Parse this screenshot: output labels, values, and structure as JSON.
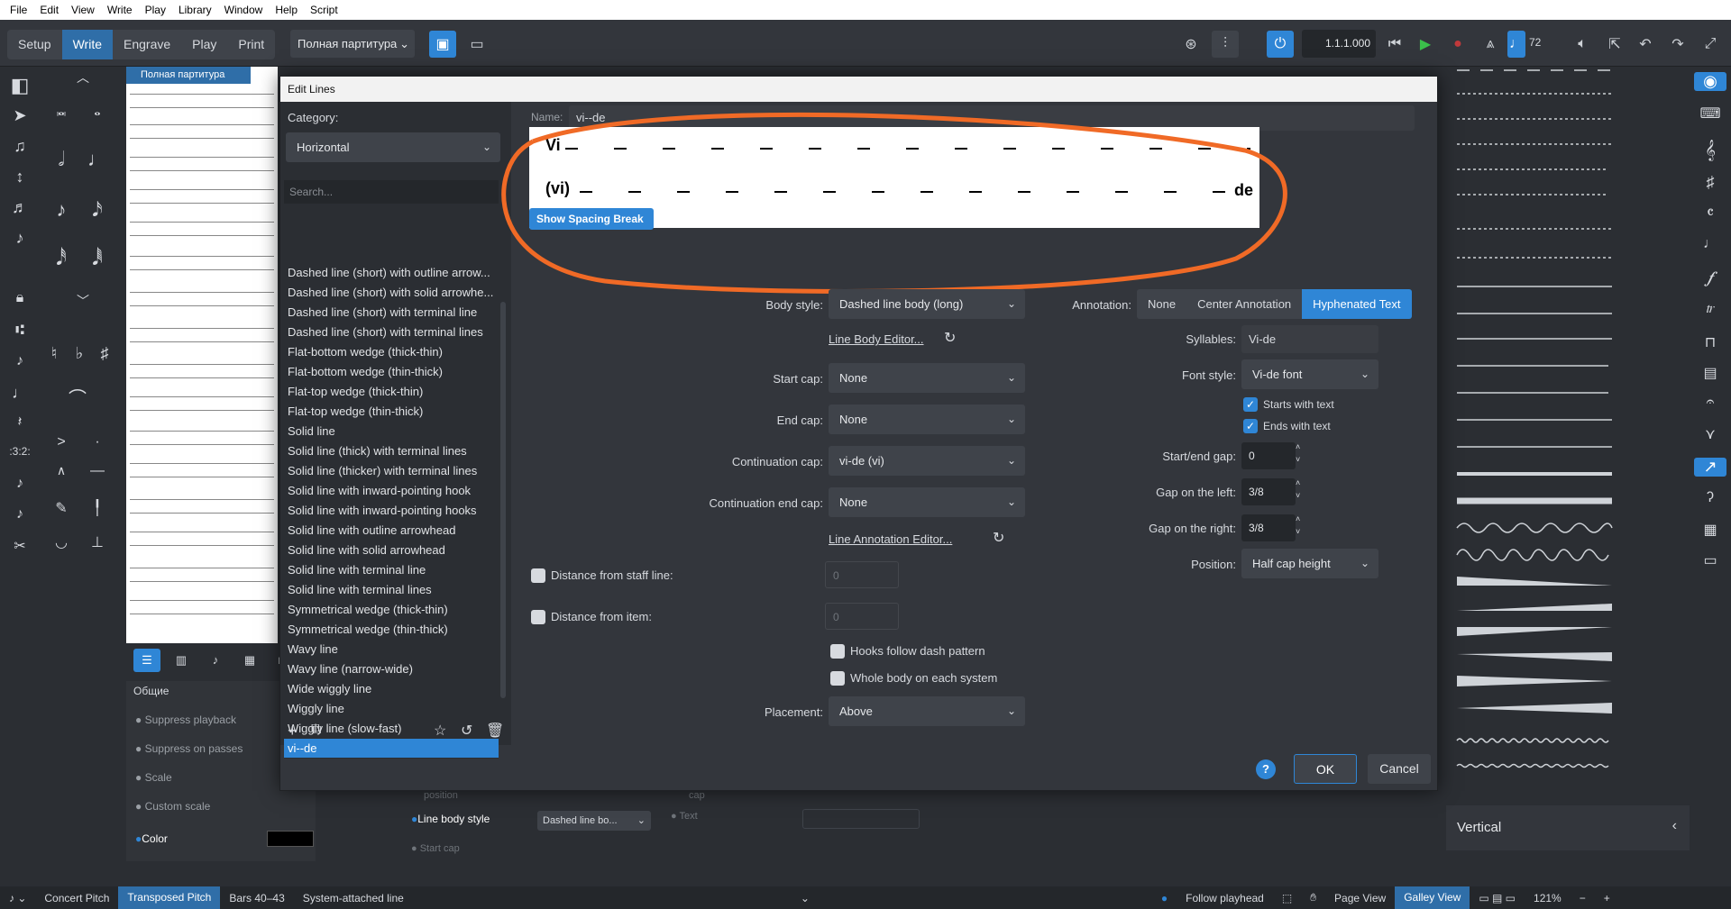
{
  "menu": [
    "File",
    "Edit",
    "View",
    "Write",
    "Play",
    "Library",
    "Window",
    "Help",
    "Script"
  ],
  "modes": [
    "Setup",
    "Write",
    "Engrave",
    "Play",
    "Print"
  ],
  "active_mode": "Write",
  "layout": "Полная партитура",
  "position": "1.1.1.000",
  "tempo": "72",
  "score_tab": "Полная партитура",
  "dialog": {
    "title": "Edit Lines",
    "category_label": "Category:",
    "category": "Horizontal",
    "search_placeholder": "Search...",
    "lines": [
      "Dashed line (short) with outline arrow...",
      "Dashed line (short) with solid arrowhe...",
      "Dashed line (short) with terminal line",
      "Dashed line (short) with terminal lines",
      "Flat-bottom wedge (thick-thin)",
      "Flat-bottom wedge (thin-thick)",
      "Flat-top wedge (thick-thin)",
      "Flat-top wedge (thin-thick)",
      "Solid line",
      "Solid line (thick) with terminal lines",
      "Solid line (thicker) with terminal lines",
      "Solid line with inward-pointing hook",
      "Solid line with inward-pointing hooks",
      "Solid line with outline arrowhead",
      "Solid line with solid arrowhead",
      "Solid line with terminal line",
      "Solid line with terminal lines",
      "Symmetrical wedge (thick-thin)",
      "Symmetrical wedge (thin-thick)",
      "Wavy line",
      "Wavy line (narrow-wide)",
      "Wide wiggly line",
      "Wiggly line",
      "Wiggly line (slow-fast)",
      "vi--de"
    ],
    "selected_line": "vi--de",
    "name_label": "Name:",
    "name_value": "vi--de",
    "preview": {
      "row1_start": "Vi",
      "row2_start": "(vi)",
      "row2_end": "de"
    },
    "show_break_label": "Show Spacing Break",
    "body_style_label": "Body style:",
    "body_style": "Dashed line body (long)",
    "line_body_editor": "Line Body Editor...",
    "start_cap_label": "Start cap:",
    "start_cap": "None",
    "end_cap_label": "End cap:",
    "end_cap": "None",
    "continuation_cap_label": "Continuation cap:",
    "continuation_cap": "vi-de (vi)",
    "continuation_end_cap_label": "Continuation end cap:",
    "continuation_end_cap": "None",
    "line_annotation_editor": "Line Annotation Editor...",
    "distance_staff_label": "Distance from staff line:",
    "distance_staff_value": "0",
    "distance_item_label": "Distance from item:",
    "distance_item_value": "0",
    "hooks_follow_label": "Hooks follow dash pattern",
    "whole_body_label": "Whole body on each system",
    "placement_label": "Placement:",
    "placement": "Above",
    "annotation_label": "Annotation:",
    "annotation_options": [
      "None",
      "Center Annotation",
      "Hyphenated Text"
    ],
    "annotation_selected": "Hyphenated Text",
    "syllables_label": "Syllables:",
    "syllables": "Vi-de",
    "font_style_label": "Font style:",
    "font_style": "Vi-de font",
    "starts_with_text": "Starts with text",
    "ends_with_text": "Ends with text",
    "start_end_gap_label": "Start/end gap:",
    "start_end_gap": "0",
    "gap_left_label": "Gap on the left:",
    "gap_left": "3/8",
    "gap_right_label": "Gap on the right:",
    "gap_right": "3/8",
    "position_label": "Position:",
    "position": "Half cap height",
    "help": "?",
    "ok": "OK",
    "cancel": "Cancel"
  },
  "properties": {
    "header": "Общие",
    "items": [
      "Suppress playback",
      "Suppress on passes",
      "Scale",
      "Custom scale",
      "Color"
    ],
    "extra": [
      "position",
      "Line body style",
      "Start cap",
      "cap",
      "Text"
    ],
    "line_body_value": "Dashed line bo..."
  },
  "right_panel": {
    "footer": "Vertical"
  },
  "status": {
    "concert": "Concert Pitch",
    "transposed": "Transposed Pitch",
    "bars": "Bars 40–43",
    "selection": "System-attached line",
    "follow": "Follow playhead",
    "page_view": "Page View",
    "galley_view": "Galley View",
    "zoom": "121%"
  },
  "colors": {
    "accent": "#2f86d6",
    "annotation_circle": "#f06a26"
  }
}
